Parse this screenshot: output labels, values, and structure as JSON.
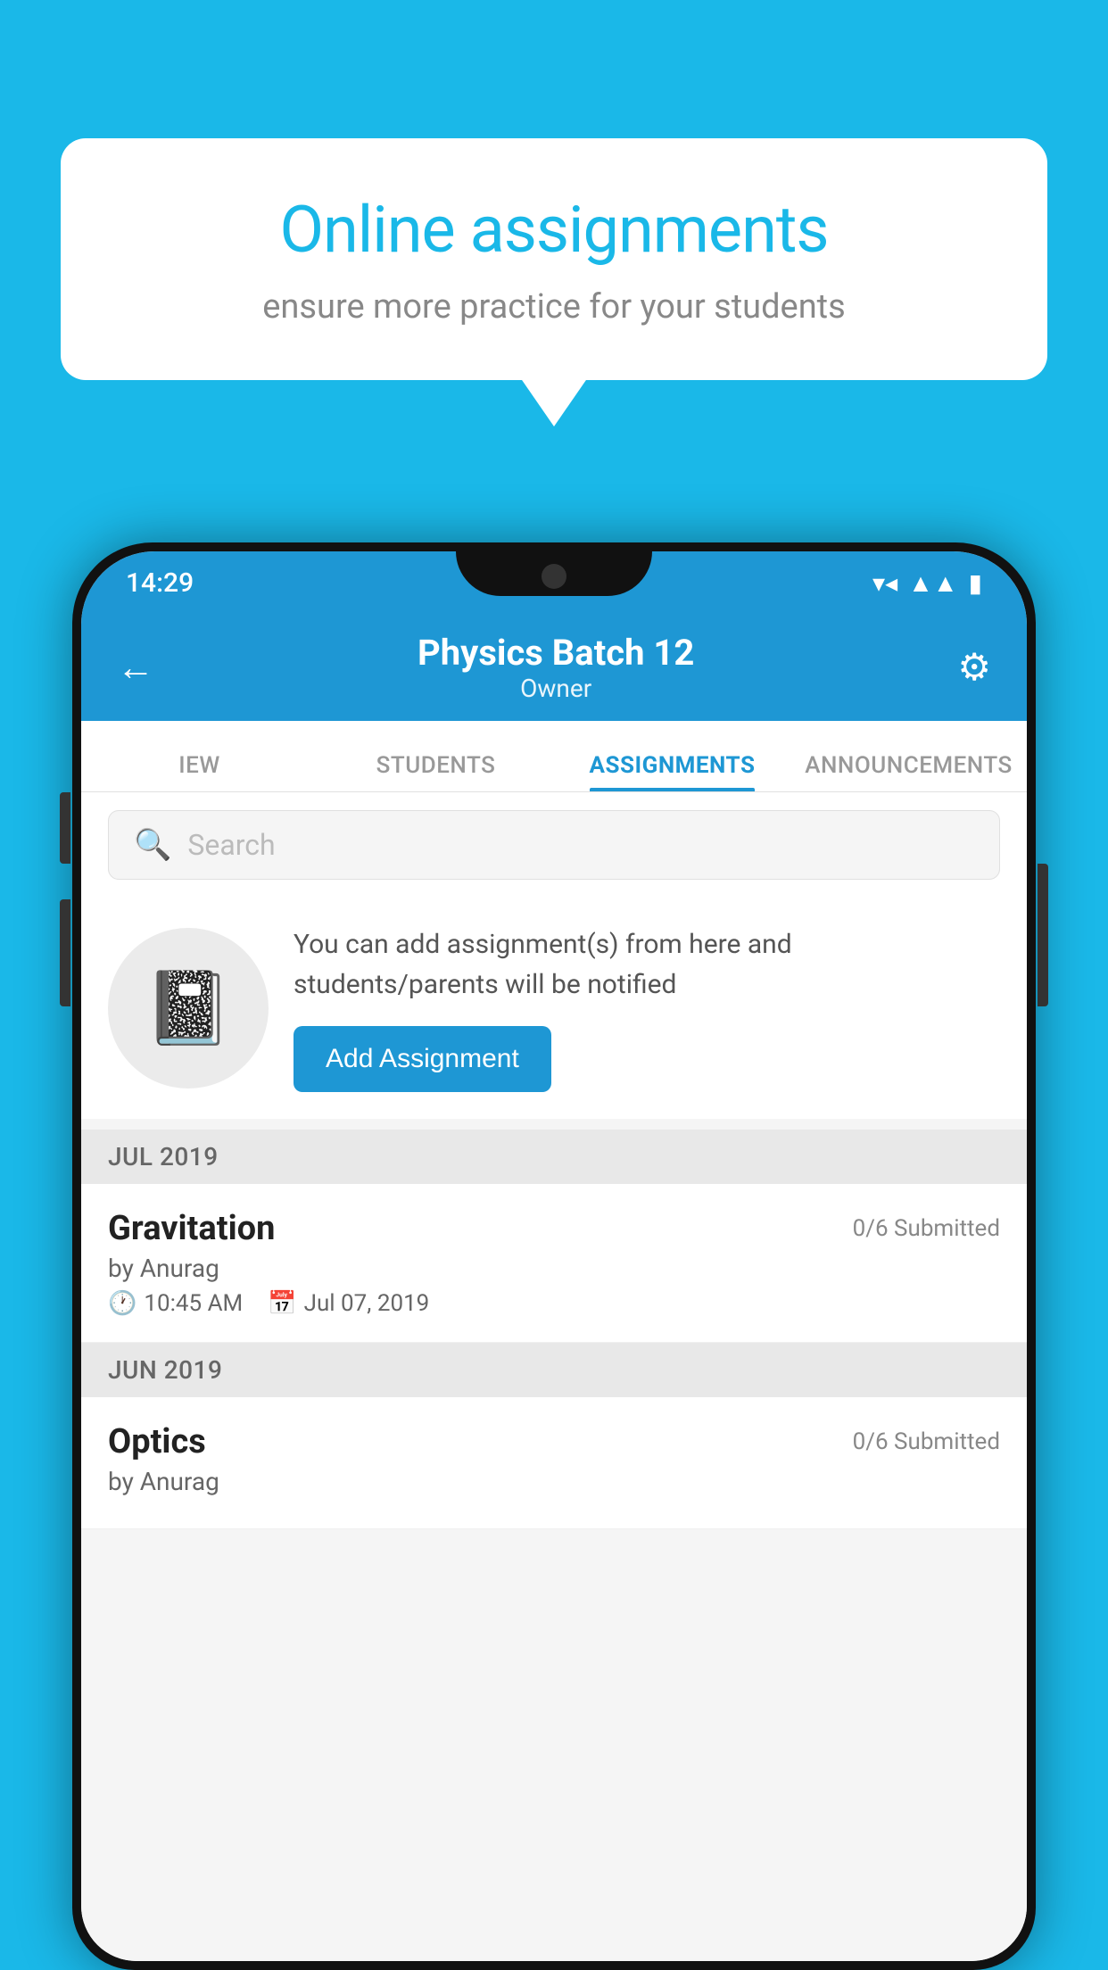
{
  "background_color": "#1ab8e8",
  "speech_bubble": {
    "title": "Online assignments",
    "subtitle": "ensure more practice for your students"
  },
  "phone": {
    "status_bar": {
      "time": "14:29",
      "icons": [
        "wifi",
        "signal",
        "battery"
      ]
    },
    "header": {
      "title": "Physics Batch 12",
      "subtitle": "Owner",
      "back_label": "←",
      "settings_label": "⚙"
    },
    "tabs": [
      {
        "label": "IEW",
        "active": false
      },
      {
        "label": "STUDENTS",
        "active": false
      },
      {
        "label": "ASSIGNMENTS",
        "active": true
      },
      {
        "label": "ANNOUNCEMENTS",
        "active": false
      }
    ],
    "search": {
      "placeholder": "Search"
    },
    "promo": {
      "icon": "📓",
      "text": "You can add assignment(s) from here and students/parents will be notified",
      "button_label": "Add Assignment"
    },
    "sections": [
      {
        "label": "JUL 2019",
        "assignments": [
          {
            "title": "Gravitation",
            "status": "0/6 Submitted",
            "author": "by Anurag",
            "time": "10:45 AM",
            "date": "Jul 07, 2019"
          }
        ]
      },
      {
        "label": "JUN 2019",
        "assignments": [
          {
            "title": "Optics",
            "status": "0/6 Submitted",
            "author": "by Anurag",
            "time": "",
            "date": ""
          }
        ]
      }
    ]
  }
}
